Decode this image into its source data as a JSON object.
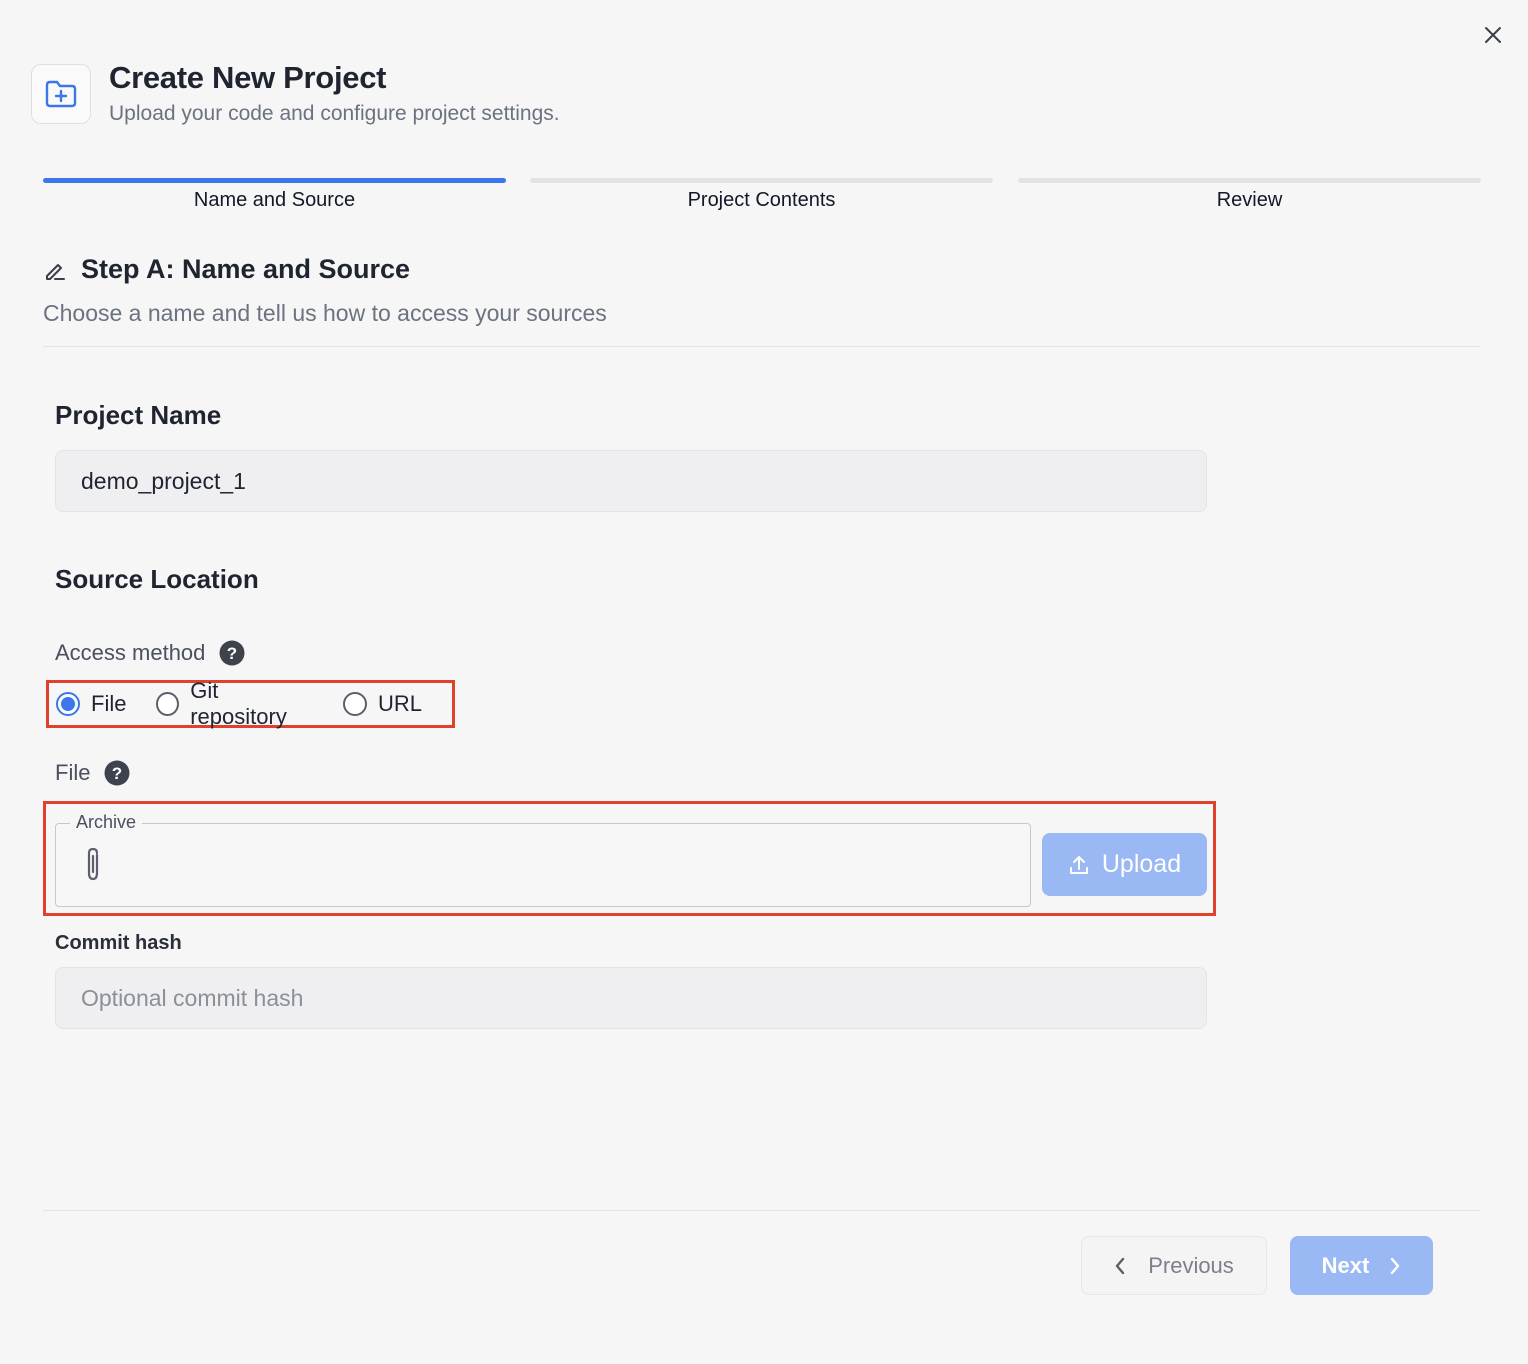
{
  "header": {
    "title": "Create New Project",
    "subtitle": "Upload your code and configure project settings.",
    "icon": "folder-plus-icon",
    "close_icon": "close-icon"
  },
  "stepper": {
    "steps": [
      {
        "label": "Name and Source",
        "active": true
      },
      {
        "label": "Project Contents",
        "active": false
      },
      {
        "label": "Review",
        "active": false
      }
    ],
    "accent_color": "#3b76ea"
  },
  "step": {
    "title": "Step A: Name and Source",
    "description": "Choose a name and tell us how to access your sources",
    "icon": "edit-pencil-icon"
  },
  "project_name": {
    "label": "Project Name",
    "value": "demo_project_1"
  },
  "source": {
    "title": "Source Location",
    "access_method_label": "Access method",
    "access_options": [
      "File",
      "Git repository",
      "URL"
    ],
    "selected_access": "File",
    "file_label": "File",
    "archive_label": "Archive",
    "upload_label": "Upload",
    "commit_label": "Commit hash",
    "commit_placeholder": "Optional commit hash"
  },
  "footer": {
    "previous_label": "Previous",
    "next_label": "Next"
  },
  "colors": {
    "highlight_border": "#e0412e",
    "button_disabled_blue": "#9ab8f3"
  }
}
